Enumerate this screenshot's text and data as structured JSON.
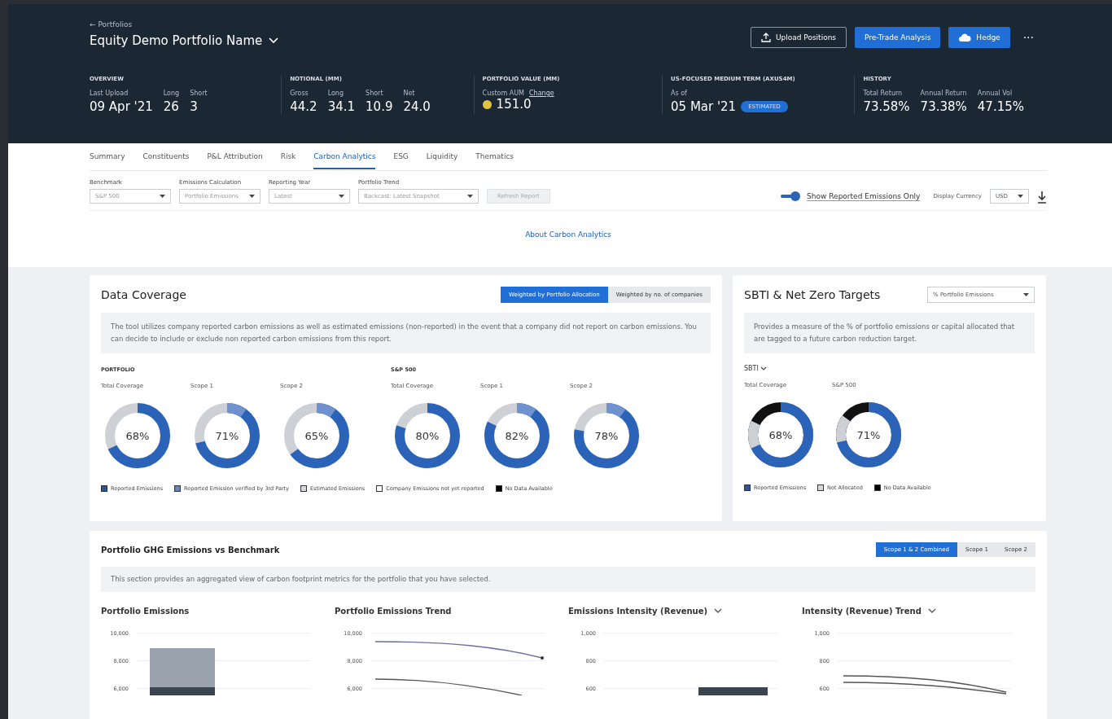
{
  "header": {
    "breadcrumb": "← Portfolios",
    "title": "Equity Demo Portfolio Name",
    "buttons": [
      {
        "label": "Upload Positions",
        "kind": "outline"
      },
      {
        "label": "Pre-Trade Analysis",
        "kind": "primary"
      },
      {
        "label": "Hedge",
        "kind": "primary-cloud"
      }
    ],
    "more": "···"
  },
  "stats": [
    {
      "heading": "OVERVIEW",
      "items": [
        {
          "label": "Last Upload",
          "value": "09 Apr '21"
        },
        {
          "label": "Long",
          "value": "26"
        },
        {
          "label": "Short",
          "value": "3"
        }
      ]
    },
    {
      "heading": "NOTIONAL (MM)",
      "items": [
        {
          "label": "Gross",
          "value": "44.2"
        },
        {
          "label": "Long",
          "value": "34.1"
        },
        {
          "label": "Short",
          "value": "10.9"
        },
        {
          "label": "Net",
          "value": "24.0"
        }
      ]
    },
    {
      "heading": "PORTFOLIO VALUE (MM)",
      "note": "Custom AUM",
      "link": "Change",
      "items": [
        {
          "value": "151.0"
        }
      ]
    },
    {
      "heading": "US-FOCUSED MEDIUM TERM (AXUS4M)",
      "items": [
        {
          "label": "As of",
          "value": "05 Mar '21",
          "badge": "ESTIMATED"
        }
      ]
    },
    {
      "heading": "HISTORY",
      "items": [
        {
          "label": "Total Return",
          "value": "73.58%"
        },
        {
          "label": "Annual Return",
          "value": "73.38%"
        },
        {
          "label": "Annual Vol",
          "value": "47.15%"
        }
      ]
    }
  ],
  "tabs": [
    {
      "label": "Summary",
      "selected": false
    },
    {
      "label": "Constituents",
      "selected": false
    },
    {
      "label": "P&L Attribution",
      "selected": false
    },
    {
      "label": "Risk",
      "selected": false
    },
    {
      "label": "Carbon Analytics",
      "selected": true
    },
    {
      "label": "ESG",
      "selected": false
    },
    {
      "label": "Liquidity",
      "selected": false
    },
    {
      "label": "Thematics",
      "selected": false
    }
  ],
  "filters": [
    {
      "label": "Benchmark",
      "value": "S&P 500"
    },
    {
      "label": "Emissions Calculation",
      "value": "Portfolio Emissions"
    },
    {
      "label": "Reporting Year",
      "value": "Latest"
    },
    {
      "label": "Portfolio Trend",
      "value": "Backcast: Latest Snapshot"
    }
  ],
  "refresh_button": {
    "label": "Refresh Report",
    "disabled": true
  },
  "toggle": {
    "label": "Show Reported Emissions Only",
    "on": true
  },
  "currency": {
    "label": "Display Currency",
    "value": "USD"
  },
  "about_link": "About Carbon Analytics",
  "data_coverage": {
    "title": "Data Coverage",
    "segments": [
      {
        "label": "Weighted by Portfolio Allocation",
        "selected": true
      },
      {
        "label": "Weighted by no. of companies",
        "selected": false
      }
    ],
    "description": "The tool utilizes company reported carbon emissions as well as estimated emissions (non-reported) in the event that a company did not report on carbon emissions. You can decide to include or exclude non reported carbon emissions from this report.",
    "groups": [
      {
        "heading": "PORTFOLIO",
        "donuts": [
          {
            "label": "Total Coverage",
            "value": "68%",
            "level": 0.68
          },
          {
            "label": "Scope 1",
            "value": "71%",
            "level": 0.71
          },
          {
            "label": "Scope 2",
            "value": "65%",
            "level": 0.65
          }
        ]
      },
      {
        "heading": "S&P 500",
        "donuts": [
          {
            "label": "Total Coverage",
            "value": "80%",
            "level": 0.8
          },
          {
            "label": "Scope 1",
            "value": "82%",
            "level": 0.82
          },
          {
            "label": "Scope 2",
            "value": "78%",
            "level": 0.78
          }
        ]
      }
    ],
    "legend": [
      {
        "label": "Reported Emissions",
        "color": "#2f5597"
      },
      {
        "label": "Reported Emission verified by 3rd Party",
        "color": "#6a86b8"
      },
      {
        "label": "Estimated Emissions",
        "color": "#d5d8dc"
      },
      {
        "label": "Company Emissions not yet reported",
        "color": "#ffffff"
      },
      {
        "label": "No Data Available",
        "color": "#000000"
      }
    ]
  },
  "sbti": {
    "title": "SBTI & Net Zero Targets",
    "dropdown": "% Portfolio Emissions",
    "description": "Provides a measure of the % of portfolio emissions or capital allocated that are tagged to a future carbon reduction target.",
    "selector": "SBTI",
    "donuts": [
      {
        "label": "Total Coverage",
        "value": "68%",
        "level": 0.68
      },
      {
        "label": "S&P 500",
        "value": "71%",
        "level": 0.71
      }
    ],
    "legend": [
      {
        "label": "Reported Emissions",
        "color": "#2f5597"
      },
      {
        "label": "Not Allocated",
        "color": "#d5d8dc"
      },
      {
        "label": "No Data Available",
        "color": "#000000"
      }
    ]
  },
  "ghg": {
    "title": "Portfolio GHG Emissions vs Benchmark",
    "segments": [
      {
        "label": "Scope 1 & 2 Combined",
        "selected": true
      },
      {
        "label": "Scope 1",
        "selected": false
      },
      {
        "label": "Scope 2",
        "selected": false
      }
    ],
    "description": "This section provides an aggregated view of carbon footprint metrics for the portfolio that you have selected.",
    "panels": [
      {
        "title": "Portfolio Emissions",
        "dropdown": false,
        "kind": "bar",
        "ticks": [
          "10,000",
          "8,000",
          "6,000"
        ]
      },
      {
        "title": "Portfolio Emissions Trend",
        "dropdown": false,
        "kind": "line",
        "ticks": [
          "10,000",
          "8,000",
          "6,000"
        ]
      },
      {
        "title": "Emissions Intensity (Revenue)",
        "dropdown": true,
        "kind": "bar-single",
        "ticks": [
          "1,000",
          "800",
          "600"
        ]
      },
      {
        "title": "Intensity (Revenue) Trend",
        "dropdown": true,
        "kind": "line-flat",
        "ticks": [
          "1,000",
          "800",
          "600"
        ]
      }
    ]
  }
}
